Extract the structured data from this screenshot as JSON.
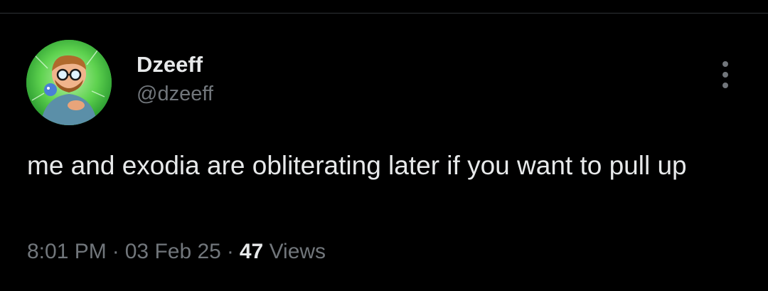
{
  "tweet": {
    "author": {
      "display_name": "Dzeeff",
      "handle": "@dzeeff"
    },
    "text": "me and exodia are obliterating later if you want to pull up",
    "time": "8:01 PM",
    "date": "03 Feb 25",
    "separator": "·",
    "views_count": "47",
    "views_label": "Views"
  },
  "icons": {
    "more": "more-vertical-icon"
  },
  "colors": {
    "background": "#000000",
    "text_primary": "#e7e9ea",
    "text_secondary": "#71767b",
    "divider": "#2f3336",
    "avatar_ring": "#3fbf3a"
  }
}
